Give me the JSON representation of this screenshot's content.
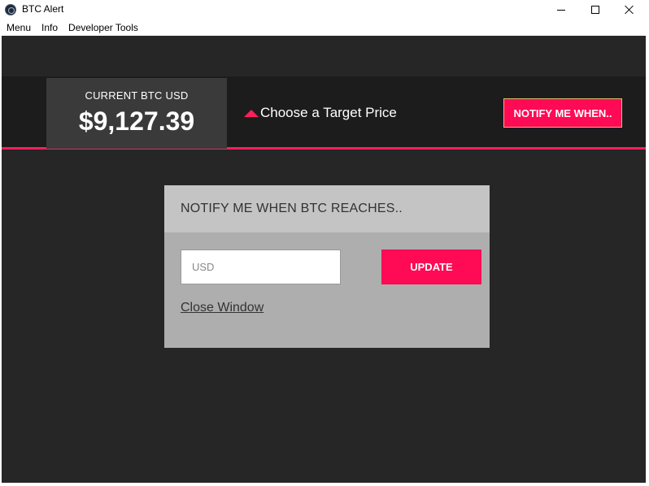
{
  "window": {
    "title": "BTC Alert",
    "icon": "electron-app-icon"
  },
  "menubar": {
    "items": [
      "Menu",
      "Info",
      "Developer Tools"
    ]
  },
  "header": {
    "price_label": "CURRENT BTC USD",
    "price_value": "$9,127.39",
    "target_text": "Choose a Target Price",
    "notify_button": "NOTIFY ME WHEN.."
  },
  "dialog": {
    "title": "NOTIFY ME WHEN BTC REACHES..",
    "input_placeholder": "USD",
    "input_value": "",
    "update_button": "UPDATE",
    "close_link": "Close Window"
  },
  "colors": {
    "accent": "#ff0a55",
    "background": "#262626",
    "header_band": "#1c1c1c",
    "price_box": "#3a3a3a",
    "dialog_body": "#aeaeae",
    "dialog_header": "#c4c4c4"
  }
}
